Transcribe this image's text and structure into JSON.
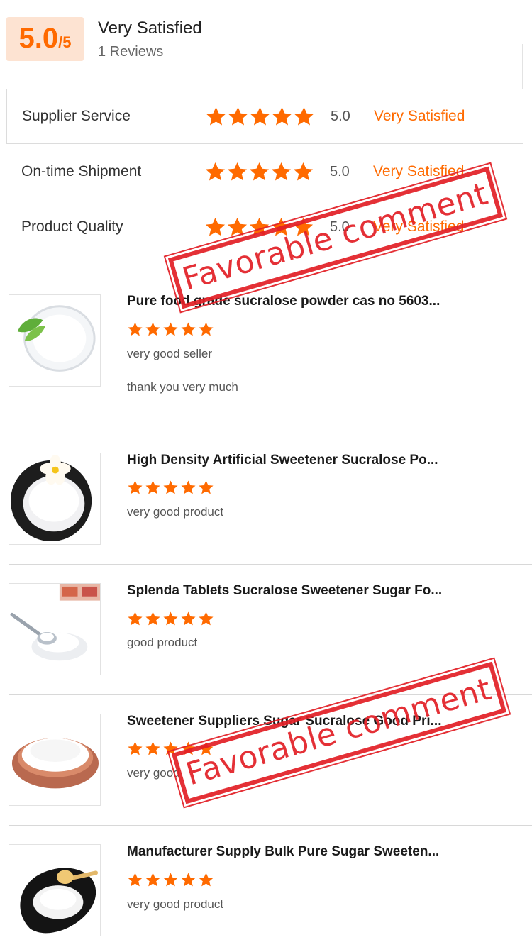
{
  "summary": {
    "score": "5.0",
    "score_out_of": "/5",
    "title": "Very Satisfied",
    "reviews_count": "1 Reviews"
  },
  "ratings": [
    {
      "label": "Supplier Service",
      "stars": 5,
      "value": "5.0",
      "verdict": "Very Satisfied"
    },
    {
      "label": "On-time Shipment",
      "stars": 5,
      "value": "5.0",
      "verdict": "Very Satisfied"
    },
    {
      "label": "Product Quality",
      "stars": 5,
      "value": "5.0",
      "verdict": "Very Satisfied"
    }
  ],
  "reviews": [
    {
      "product_title": "Pure food grade sucralose powder cas no 5603...",
      "stars": 5,
      "comment": "very good seller",
      "extra": "thank you very much"
    },
    {
      "product_title": "High Density Artificial Sweetener Sucralose Po...",
      "stars": 5,
      "comment": "very good product"
    },
    {
      "product_title": "Splenda Tablets Sucralose Sweetener Sugar Fo...",
      "stars": 5,
      "comment": "good product"
    },
    {
      "product_title": "Sweetener Suppliers Sugar Sucralose Good Pri...",
      "stars": 5,
      "comment": "very good"
    },
    {
      "product_title": "Manufacturer Supply Bulk Pure Sugar Sweeten...",
      "stars": 5,
      "comment": "very good product"
    }
  ],
  "stamps": {
    "top": "Favorable comment",
    "bottom": "Favorable comment"
  },
  "colors": {
    "accent": "#ff6a00",
    "score_bg": "#fde3d2",
    "stamp": "#e21f26"
  }
}
